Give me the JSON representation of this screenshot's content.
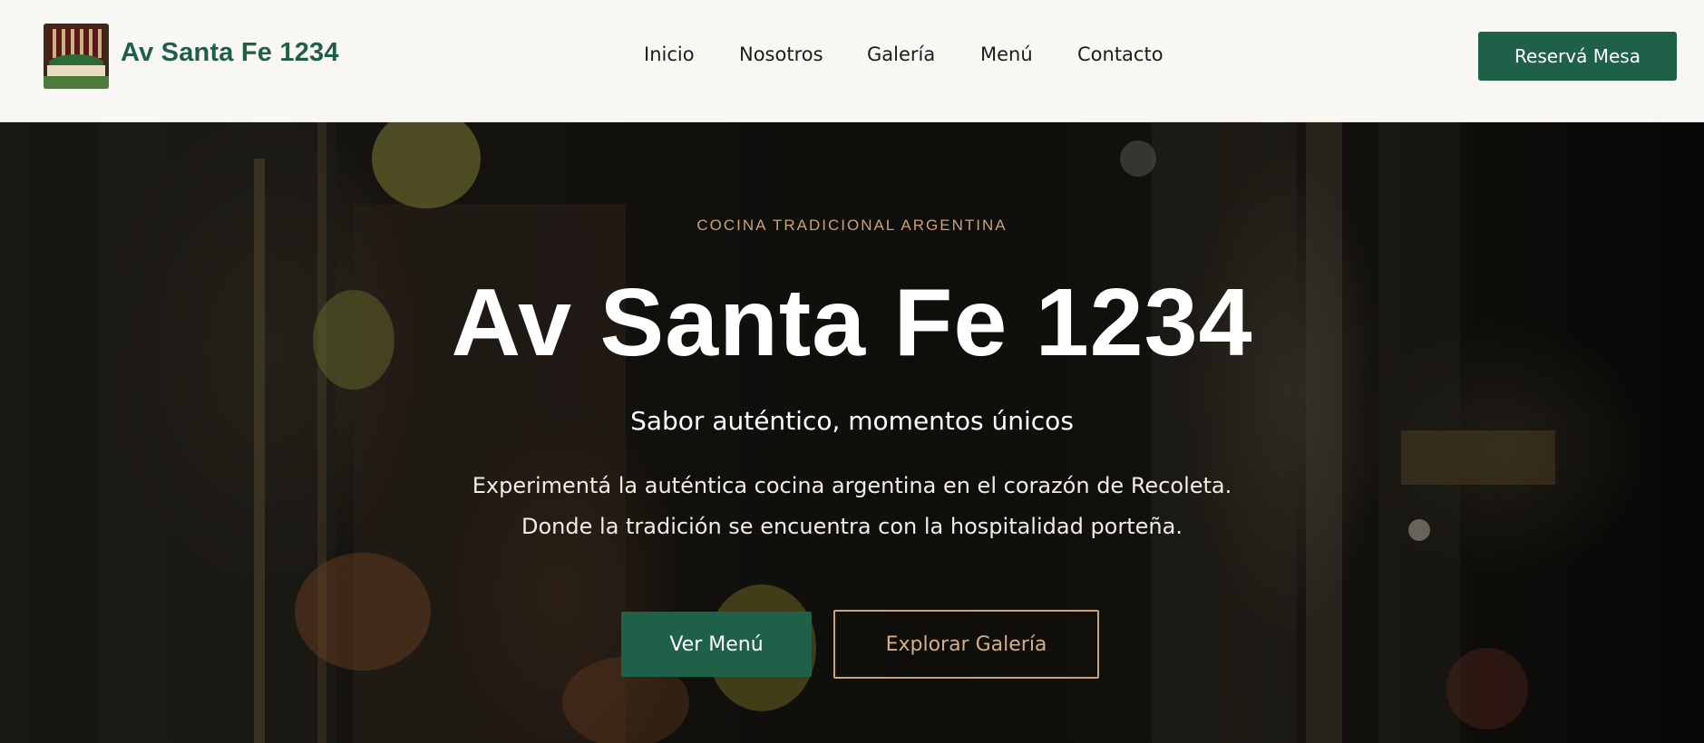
{
  "header": {
    "logo_icon": "restaurant-storefront-logo",
    "brand": "Av Santa Fe 1234",
    "nav": [
      {
        "label": "Inicio"
      },
      {
        "label": "Nosotros"
      },
      {
        "label": "Galería"
      },
      {
        "label": "Menú"
      },
      {
        "label": "Contacto"
      }
    ],
    "cta": "Reservá Mesa"
  },
  "hero": {
    "eyebrow": "COCINA TRADICIONAL ARGENTINA",
    "title": "Av Santa Fe 1234",
    "subtitle": "Sabor auténtico, momentos únicos",
    "description_line1": "Experimentá la auténtica cocina argentina en el corazón de Recoleta.",
    "description_line2": "Donde la tradición se encuentra con la hospitalidad porteña.",
    "primary_button": "Ver Menú",
    "secondary_button": "Explorar Galería"
  },
  "colors": {
    "brand_green": "#1f6049",
    "accent_gold": "#c9a27a",
    "header_bg": "#f8f7f4"
  }
}
